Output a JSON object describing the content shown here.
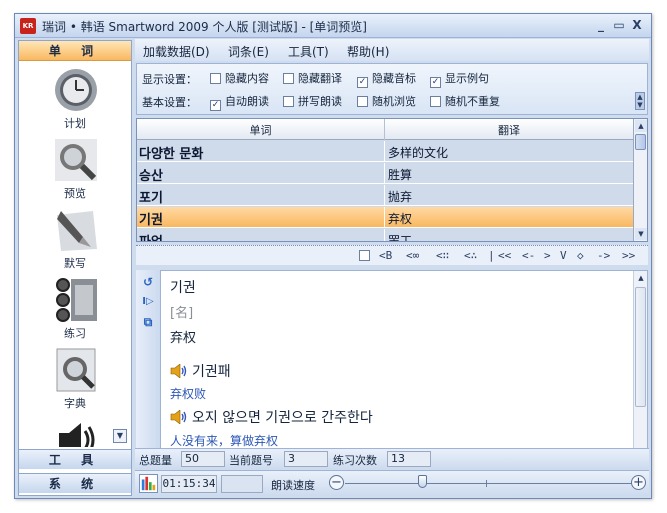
{
  "window": {
    "title": "瑞词 • 韩语 Smartword 2009 个人版 [测试版] - [单词预览]",
    "app_icon": "KR",
    "minimize": "_",
    "maximize": "▭",
    "close": "X"
  },
  "left_panel": {
    "section_words": "单 词",
    "items": [
      {
        "label": "计划",
        "icon": "clock-icon"
      },
      {
        "label": "预览",
        "icon": "magnifier-icon"
      },
      {
        "label": "默写",
        "icon": "pen-icon"
      },
      {
        "label": "练习",
        "icon": "chain-icon"
      },
      {
        "label": "字典",
        "icon": "dictionary-icon"
      },
      {
        "label": "",
        "icon": "speaker-icon"
      }
    ],
    "section_tools": "工 具",
    "section_system": "系 统",
    "scroll_down": "▼"
  },
  "menubar": {
    "items": [
      "加载数据(D)",
      "词条(E)",
      "工具(T)",
      "帮助(H)"
    ]
  },
  "settings": {
    "display_label": "显示设置：",
    "basic_label": "基本设置：",
    "display_options": [
      {
        "label": "隐藏内容",
        "checked": false
      },
      {
        "label": "隐藏翻译",
        "checked": false
      },
      {
        "label": "隐藏音标",
        "checked": true
      },
      {
        "label": "显示例句",
        "checked": true
      }
    ],
    "basic_options": [
      {
        "label": "自动朗读",
        "checked": true
      },
      {
        "label": "拼写朗读",
        "checked": false
      },
      {
        "label": "随机浏览",
        "checked": false
      },
      {
        "label": "随机不重复",
        "checked": false
      }
    ]
  },
  "word_table": {
    "headers": [
      "单词",
      "翻译"
    ],
    "rows": [
      {
        "word": "다양한 문화",
        "translation": "多样的文化",
        "selected": false
      },
      {
        "word": "승산",
        "translation": "胜算",
        "selected": false
      },
      {
        "word": "포기",
        "translation": "抛弃",
        "selected": false
      },
      {
        "word": "기권",
        "translation": "弃权",
        "selected": true
      },
      {
        "word": "파업",
        "translation": "罢工",
        "selected": false
      }
    ],
    "scroll_up": "▲",
    "scroll_down": "▼"
  },
  "nav_bar": {
    "buttons": [
      "<B",
      "<∞",
      "<∷",
      "<∴",
      "|",
      "<<",
      "<-",
      ">",
      "V",
      "◇",
      "->",
      ">>"
    ]
  },
  "detail": {
    "word": "기권",
    "pos": "[名]",
    "meaning": "弃权",
    "examples": [
      {
        "korean": "기권패",
        "chinese": "弃权败"
      },
      {
        "korean": "오지 않으면 기권으로 간주한다",
        "chinese": "人没有来，算做弃权"
      }
    ],
    "tools": [
      "↺",
      "I▷",
      "⧉"
    ],
    "scroll_up": "▲",
    "scroll_down": "▼"
  },
  "status": {
    "total_label": "总题量",
    "total_value": "50",
    "current_label": "当前题号",
    "current_value": "3",
    "practice_label": "练习次数",
    "practice_value": "13",
    "timer": "01:15:34",
    "speed_label": "朗读速度",
    "speed_minus": "−",
    "speed_plus": "+",
    "speed_level": 0.27
  },
  "colors": {
    "selected_row": "#fbc47c",
    "accent_header": "#f9b860",
    "frame": "#cfdcee"
  }
}
